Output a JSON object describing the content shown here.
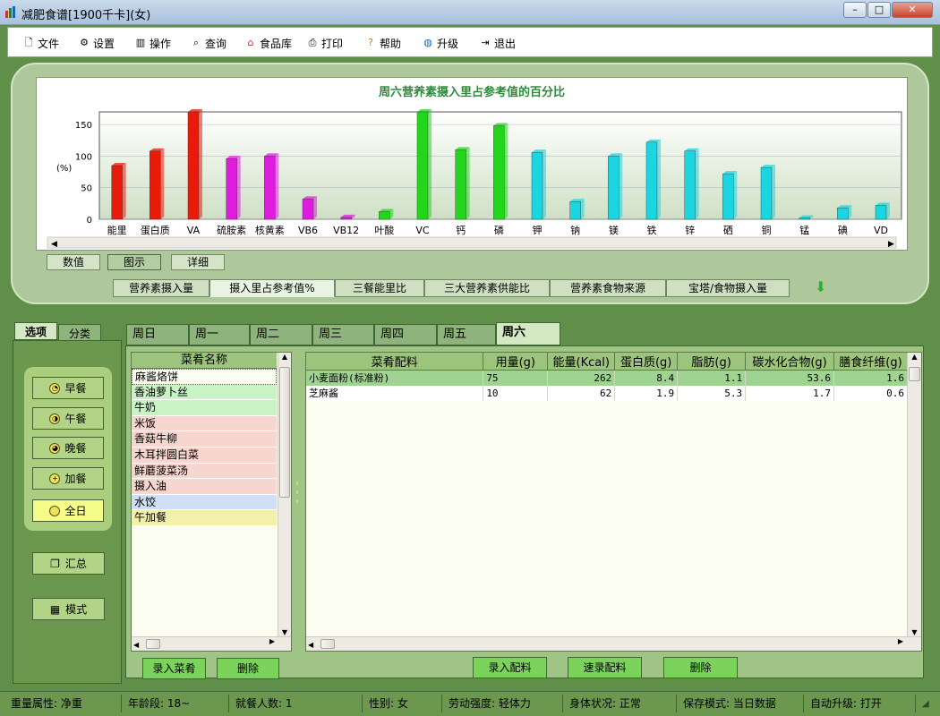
{
  "window": {
    "title": "减肥食谱[1900千卡](女)"
  },
  "menu": [
    {
      "label": "文件",
      "icon": "file-icon"
    },
    {
      "label": "设置",
      "icon": "settings-icon"
    },
    {
      "label": "操作",
      "icon": "operate-icon"
    },
    {
      "label": "查询",
      "icon": "query-icon"
    },
    {
      "label": "食品库",
      "icon": "food-db-icon"
    },
    {
      "label": "打印",
      "icon": "print-icon"
    },
    {
      "label": "帮助",
      "icon": "help-icon"
    },
    {
      "label": "升级",
      "icon": "upgrade-icon"
    },
    {
      "label": "退出",
      "icon": "exit-icon"
    }
  ],
  "chart_view_buttons": [
    "数值",
    "图示",
    "详细"
  ],
  "chart_tabs": [
    "营养素摄入量",
    "摄入里占参考值%",
    "三餐能里比",
    "三大营养素供能比",
    "营养素食物来源",
    "宝塔/食物摄入量"
  ],
  "chart_data": {
    "type": "bar",
    "title": "周六营养素摄入里占参考值的百分比",
    "ylabel": "(%)",
    "ylim": [
      0,
      170
    ],
    "yticks": [
      0,
      50,
      100,
      150
    ],
    "categories": [
      "能里",
      "蛋白质",
      "VA",
      "硫胺素",
      "核黄素",
      "VB6",
      "VB12",
      "叶酸",
      "VC",
      "钙",
      "磷",
      "钾",
      "钠",
      "镁",
      "铁",
      "锌",
      "硒",
      "铜",
      "锰",
      "碘",
      "VD"
    ],
    "values": [
      85,
      108,
      170,
      96,
      100,
      32,
      3,
      12,
      170,
      110,
      148,
      106,
      28,
      100,
      122,
      108,
      72,
      82,
      2,
      18,
      22
    ],
    "colors": [
      "#e81b0b",
      "#e81b0b",
      "#e81b0b",
      "#e01be0",
      "#e01be0",
      "#e01be0",
      "#e01be0",
      "#22d71b",
      "#22d71b",
      "#22d71b",
      "#22d71b",
      "#1bd6e0",
      "#1bd6e0",
      "#1bd6e0",
      "#1bd6e0",
      "#1bd6e0",
      "#1bd6e0",
      "#1bd6e0",
      "#1bd6e0",
      "#1bd6e0",
      "#1bd6e0"
    ]
  },
  "side_tabs": [
    "选项",
    "分类"
  ],
  "meals": [
    {
      "label": "早餐",
      "selected": false
    },
    {
      "label": "午餐",
      "selected": false
    },
    {
      "label": "晚餐",
      "selected": false
    },
    {
      "label": "加餐",
      "selected": false
    },
    {
      "label": "全日",
      "selected": true
    }
  ],
  "summary_label": "汇总",
  "template_label": "模式",
  "days": [
    "周日",
    "周一",
    "周二",
    "周三",
    "周四",
    "周五",
    "周六"
  ],
  "selected_day": "周六",
  "dish_list": {
    "header": "菜肴名称",
    "items": [
      {
        "name": "麻酱烙饼",
        "color": "#fbfdf1"
      },
      {
        "name": "香油萝卜丝",
        "color": "#c8f3c4"
      },
      {
        "name": "牛奶",
        "color": "#c8f3c4"
      },
      {
        "name": "米饭",
        "color": "#f8d6d0"
      },
      {
        "name": "香菇牛柳",
        "color": "#f8d6d0"
      },
      {
        "name": "木耳拌圆白菜",
        "color": "#f8d6d0"
      },
      {
        "name": "鲜蘑菠菜汤",
        "color": "#f8d6d0"
      },
      {
        "name": "摄入油",
        "color": "#f8d6d0"
      },
      {
        "name": "水饺",
        "color": "#cfe0f6"
      },
      {
        "name": "午加餐",
        "color": "#f3f0aa"
      }
    ],
    "add_label": "录入菜肴",
    "delete_label": "删除"
  },
  "ingredients": {
    "headers": [
      "菜肴配料",
      "用量(g)",
      "能量(Kcal)",
      "蛋白质(g)",
      "脂肪(g)",
      "碳水化合物(g)",
      "膳食纤维(g)"
    ],
    "rows": [
      [
        "小麦面粉(标准粉)",
        "75",
        "262",
        "8.4",
        "1.1",
        "53.6",
        "1.6"
      ],
      [
        "芝麻酱",
        "10",
        "62",
        "1.9",
        "5.3",
        "1.7",
        "0.6"
      ]
    ],
    "add_label": "录入配料",
    "quick_label": "速录配料",
    "delete_label": "删除"
  },
  "status": [
    "重量属性: 净重",
    "年龄段: 18~",
    "就餐人数: 1",
    "性别: 女",
    "劳动强度: 轻体力",
    "身体状况: 正常",
    "保存模式: 当日数据",
    "自动升级: 打开"
  ]
}
